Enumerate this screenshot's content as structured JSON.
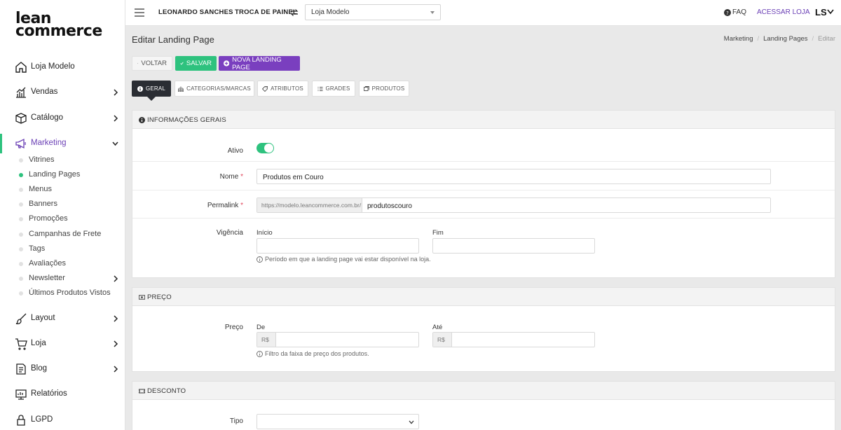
{
  "logo": {
    "line1": "lean",
    "line2": "commerce"
  },
  "sidebar": {
    "items": [
      {
        "label": "Loja Modelo"
      },
      {
        "label": "Vendas"
      },
      {
        "label": "Catálogo"
      },
      {
        "label": "Marketing"
      },
      {
        "label": "Layout"
      },
      {
        "label": "Loja"
      },
      {
        "label": "Blog"
      },
      {
        "label": "Relatórios"
      },
      {
        "label": "LGPD"
      }
    ],
    "marketing_sub": [
      {
        "label": "Vitrines"
      },
      {
        "label": "Landing Pages"
      },
      {
        "label": "Menus"
      },
      {
        "label": "Banners"
      },
      {
        "label": "Promoções"
      },
      {
        "label": "Campanhas de Frete"
      },
      {
        "label": "Tags"
      },
      {
        "label": "Avaliações"
      },
      {
        "label": "Newsletter"
      },
      {
        "label": "Últimos Produtos Vistos"
      }
    ],
    "active_item": "Marketing",
    "active_sub": "Landing Pages"
  },
  "topbar": {
    "user": "LEONARDO SANCHES",
    "switch_panel": "TROCA DE PAINEL",
    "store_select": "Loja Modelo",
    "faq": "FAQ",
    "access_store": "ACESSAR LOJA",
    "initials": "LS"
  },
  "header": {
    "title": "Editar Landing Page",
    "breadcrumb": [
      "Marketing",
      "Landing Pages",
      "Editar"
    ]
  },
  "actions": {
    "back": "VOLTAR",
    "save": "SALVAR",
    "new": "NOVA LANDING PAGE"
  },
  "tabs": [
    "GERAL",
    "CATEGORIAS/MARCAS",
    "ATRIBUTOS",
    "GRADES",
    "PRODUTOS"
  ],
  "general": {
    "heading": "INFORMAÇÕES GERAIS",
    "active_label": "Ativo",
    "active_on": true,
    "name_label": "Nome",
    "name_value": "Produtos em Couro",
    "permalink_label": "Permalink",
    "permalink_prefix": "https://modelo.leancommerce.com.br/",
    "permalink_value": "produtoscouro",
    "validity_label": "Vigência",
    "start_label": "Início",
    "end_label": "Fim",
    "validity_hint": "Período em que a landing page vai estar disponível na loja."
  },
  "price": {
    "heading": "PREÇO",
    "label": "Preço",
    "from_label": "De",
    "to_label": "Até",
    "currency": "R$",
    "hint": "Filtro da faixa de preço dos produtos."
  },
  "discount": {
    "heading": "DESCONTO",
    "type_label": "Tipo"
  },
  "colors": {
    "accent_green": "#2ec27e",
    "accent_purple": "#7a3fbf",
    "dark": "#2a2d33"
  }
}
